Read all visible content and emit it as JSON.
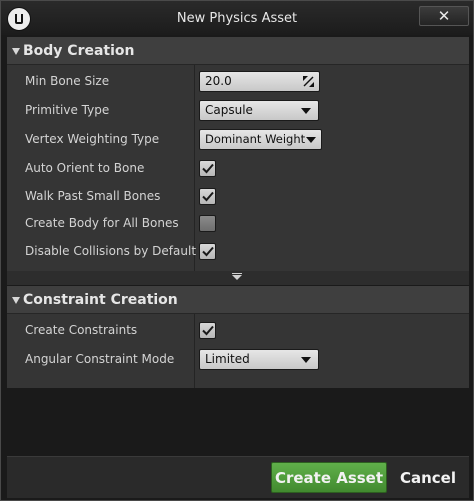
{
  "window": {
    "title": "New Physics Asset",
    "close_label": "✕"
  },
  "body_creation": {
    "header": "Body Creation",
    "min_bone_size": {
      "label": "Min Bone Size",
      "value": "20.0"
    },
    "primitive_type": {
      "label": "Primitive Type",
      "value": "Capsule"
    },
    "vertex_weighting_type": {
      "label": "Vertex Weighting Type",
      "value": "Dominant Weight"
    },
    "auto_orient_to_bone": {
      "label": "Auto Orient to Bone",
      "checked": true
    },
    "walk_past_small_bones": {
      "label": "Walk Past Small Bones",
      "checked": true
    },
    "create_body_for_all_bones": {
      "label": "Create Body for All Bones",
      "checked": false
    },
    "disable_collisions_by_default": {
      "label": "Disable Collisions by Default",
      "checked": true
    }
  },
  "constraint_creation": {
    "header": "Constraint Creation",
    "create_constraints": {
      "label": "Create Constraints",
      "checked": true
    },
    "angular_constraint_mode": {
      "label": "Angular Constraint Mode",
      "value": "Limited"
    }
  },
  "footer": {
    "create_label": "Create Asset",
    "cancel_label": "Cancel"
  },
  "colors": {
    "accent_green": "#52a23c",
    "panel_bg": "#353535",
    "header_bg": "#3f3f3f",
    "window_bg": "#1a1a1a"
  }
}
